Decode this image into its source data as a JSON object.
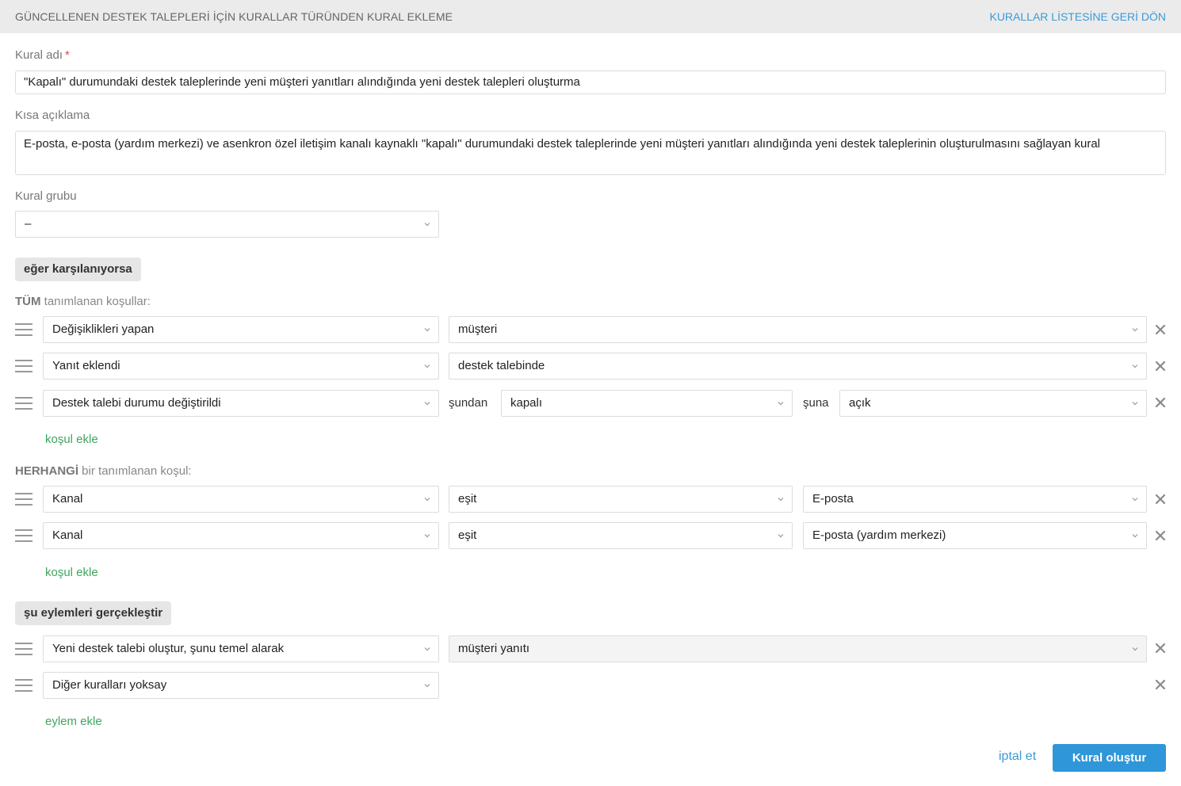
{
  "header": {
    "title": "GÜNCELLENEN DESTEK TALEPLERİ İÇİN KURALLAR TÜRÜNDEN KURAL EKLEME",
    "back_link": "KURALLAR LİSTESİNE GERİ DÖN"
  },
  "form": {
    "rule_name_label": "Kural adı",
    "required_mark": "*",
    "rule_name_value": "\"Kapalı\" durumundaki destek taleplerinde yeni müşteri yanıtları alındığında yeni destek talepleri oluşturma",
    "short_desc_label": "Kısa açıklama",
    "short_desc_value": "E-posta, e-posta (yardım merkezi) ve asenkron özel iletişim kanalı kaynaklı \"kapalı\" durumundaki destek taleplerinde yeni müşteri yanıtları alındığında yeni destek taleplerinin oluşturulmasını sağlayan kural",
    "rule_group_label": "Kural grubu",
    "rule_group_value": "–"
  },
  "conditions": {
    "section_label": "eğer karşılanıyorsa",
    "all": {
      "emphasis": "TÜM",
      "rest": " tanımlanan koşullar:",
      "rows": [
        {
          "field": "Değişiklikleri yapan",
          "value": "müşteri"
        },
        {
          "field": "Yanıt eklendi",
          "value": "destek talebinde"
        },
        {
          "field": "Destek talebi durumu değiştirildi",
          "from_label": "şundan",
          "from_value": "kapalı",
          "to_label": "şuna",
          "to_value": "açık"
        }
      ],
      "add_link": "koşul ekle"
    },
    "any": {
      "emphasis": "HERHANGİ",
      "rest": " bir tanımlanan koşul:",
      "rows": [
        {
          "field": "Kanal",
          "operator": "eşit",
          "value": "E-posta"
        },
        {
          "field": "Kanal",
          "operator": "eşit",
          "value": "E-posta (yardım merkezi)"
        }
      ],
      "add_link": "koşul ekle"
    }
  },
  "actions": {
    "section_label": "şu eylemleri gerçekleştir",
    "rows": [
      {
        "action": "Yeni destek talebi oluştur, şunu temel alarak",
        "value": "müşteri yanıtı"
      },
      {
        "action": "Diğer kuralları yoksay"
      }
    ],
    "add_link": "eylem ekle"
  },
  "footer": {
    "cancel_label": "iptal et",
    "submit_label": "Kural oluştur"
  },
  "colors": {
    "accent_blue": "#2f97d9",
    "link_green": "#3fa65f",
    "required_red": "#e04b4b",
    "header_bg": "#ebebeb"
  },
  "icons": [
    "drag-handle-icon",
    "chevron-down-icon",
    "close-icon"
  ]
}
